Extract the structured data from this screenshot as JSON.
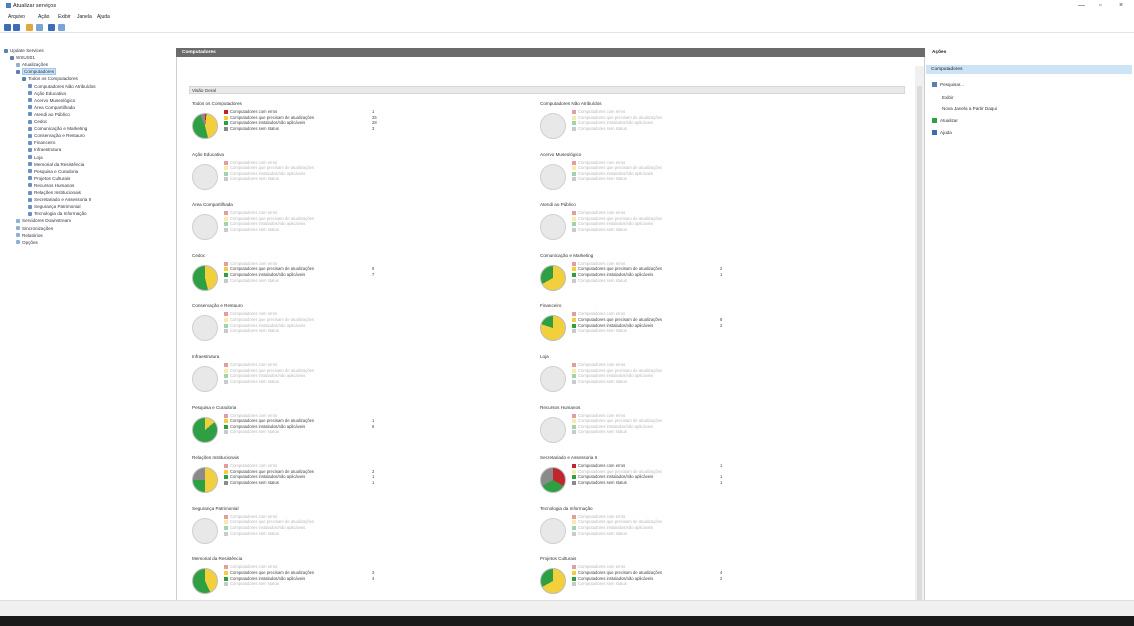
{
  "window": {
    "title": "Atualizar serviços",
    "minimize": "—",
    "maximize": "▫",
    "close": "×"
  },
  "menu": [
    "Arquivo",
    "Ação",
    "Exibir",
    "Janela",
    "Ajuda"
  ],
  "tree": [
    {
      "label": "Update Services",
      "indent": 0,
      "color": "#5b7fb0"
    },
    {
      "label": "WSUS01",
      "indent": 1,
      "color": "#5b7fb0"
    },
    {
      "label": "Atualizações",
      "indent": 2,
      "color": "#8fb0d6"
    },
    {
      "label": "Computadores",
      "indent": 2,
      "color": "#5b7fb0",
      "selected": true
    },
    {
      "label": "Todos os Computadores",
      "indent": 3,
      "color": "#5b7fb0"
    },
    {
      "label": "Computadores Não Atribuídos",
      "indent": 4,
      "color": "#6b8fbf"
    },
    {
      "label": "Ação Educativa",
      "indent": 4,
      "color": "#6b8fbf"
    },
    {
      "label": "Acervo Museológico",
      "indent": 4,
      "color": "#6b8fbf"
    },
    {
      "label": "Área Compartilhada",
      "indent": 4,
      "color": "#6b8fbf"
    },
    {
      "label": "Atendi ao Público",
      "indent": 4,
      "color": "#6b8fbf"
    },
    {
      "label": "Cedoc",
      "indent": 4,
      "color": "#6b8fbf"
    },
    {
      "label": "Comunicação e Marketing",
      "indent": 4,
      "color": "#6b8fbf"
    },
    {
      "label": "Conservação e Restauro",
      "indent": 4,
      "color": "#6b8fbf"
    },
    {
      "label": "Financeiro",
      "indent": 4,
      "color": "#6b8fbf"
    },
    {
      "label": "Infraestrutura",
      "indent": 4,
      "color": "#6b8fbf"
    },
    {
      "label": "Loja",
      "indent": 4,
      "color": "#6b8fbf"
    },
    {
      "label": "Memorial da Resistência",
      "indent": 4,
      "color": "#6b8fbf"
    },
    {
      "label": "Pesquisa e Curadoria",
      "indent": 4,
      "color": "#6b8fbf"
    },
    {
      "label": "Projetos Culturais",
      "indent": 4,
      "color": "#6b8fbf"
    },
    {
      "label": "Recursos Humanos",
      "indent": 4,
      "color": "#6b8fbf"
    },
    {
      "label": "Relações Institucionais",
      "indent": 4,
      "color": "#6b8fbf"
    },
    {
      "label": "Secretariado e Assessoria II",
      "indent": 4,
      "color": "#6b8fbf"
    },
    {
      "label": "Segurança Patrimonial",
      "indent": 4,
      "color": "#6b8fbf"
    },
    {
      "label": "Tecnologia da Informação",
      "indent": 4,
      "color": "#6b8fbf"
    },
    {
      "label": "Servidores Downstream",
      "indent": 2,
      "color": "#8fb0d6"
    },
    {
      "label": "Sincronizações",
      "indent": 2,
      "color": "#8fb0d6"
    },
    {
      "label": "Relatórios",
      "indent": 2,
      "color": "#8fb0d6"
    },
    {
      "label": "Opções",
      "indent": 2,
      "color": "#8fb0d6"
    }
  ],
  "center": {
    "header": "Computadores",
    "section": "Visão Geral"
  },
  "legend_colors": {
    "errors": "#c0262d",
    "needed": "#f2d03b",
    "installed": "#2ea043",
    "nostatus": "#8a8a8a"
  },
  "groups": [
    {
      "name": "Todos os Computadores",
      "active": true,
      "values": [
        "1",
        "25",
        "28",
        "3"
      ],
      "pie": [
        2,
        44,
        48,
        6
      ]
    },
    {
      "name": "Computadores Não Atribuídos",
      "active": false,
      "values": [
        "",
        "",
        "",
        ""
      ],
      "pie": []
    },
    {
      "name": "Ação Educativa",
      "active": false,
      "values": [
        "",
        "",
        "",
        ""
      ],
      "pie": []
    },
    {
      "name": "Acervo Museológico",
      "active": false,
      "values": [
        "",
        "",
        "",
        ""
      ],
      "pie": []
    },
    {
      "name": "Área Compartilhada",
      "active": false,
      "values": [
        "",
        "",
        "",
        ""
      ],
      "pie": []
    },
    {
      "name": "Atendi ao Público",
      "active": false,
      "values": [
        "",
        "",
        "",
        ""
      ],
      "pie": []
    },
    {
      "name": "Cedoc",
      "active": true,
      "values": [
        "",
        "6",
        "7",
        ""
      ],
      "pie": [
        0,
        46,
        54,
        0
      ]
    },
    {
      "name": "Comunicação e Marketing",
      "active": true,
      "values": [
        "",
        "2",
        "1",
        ""
      ],
      "pie": [
        0,
        67,
        33,
        0
      ]
    },
    {
      "name": "Conservação e Restauro",
      "active": false,
      "values": [
        "",
        "",
        "",
        ""
      ],
      "pie": []
    },
    {
      "name": "Financeiro",
      "active": true,
      "values": [
        "",
        "8",
        "2",
        ""
      ],
      "pie": [
        0,
        80,
        20,
        0
      ]
    },
    {
      "name": "Infraestrutura",
      "active": false,
      "values": [
        "",
        "",
        "",
        ""
      ],
      "pie": []
    },
    {
      "name": "Loja",
      "active": false,
      "values": [
        "",
        "",
        "",
        ""
      ],
      "pie": []
    },
    {
      "name": "Pesquisa e Curadoria",
      "active": true,
      "values": [
        "",
        "1",
        "6",
        ""
      ],
      "pie": [
        0,
        14,
        86,
        0
      ]
    },
    {
      "name": "Recursos Humanos",
      "active": false,
      "values": [
        "",
        "",
        "",
        ""
      ],
      "pie": []
    },
    {
      "name": "Relações Institucionais",
      "active": true,
      "values": [
        "",
        "2",
        "1",
        "1"
      ],
      "pie": [
        0,
        50,
        25,
        25
      ]
    },
    {
      "name": "Secretariado e Assessoria II",
      "active": true,
      "values": [
        "1",
        "",
        "1",
        "1"
      ],
      "pie": [
        33,
        0,
        34,
        33
      ]
    },
    {
      "name": "Segurança Patrimonial",
      "active": false,
      "values": [
        "",
        "",
        "",
        ""
      ],
      "pie": []
    },
    {
      "name": "Tecnologia da Informação",
      "active": false,
      "values": [
        "",
        "",
        "",
        ""
      ],
      "pie": []
    },
    {
      "name": "Memorial da Resistência",
      "active": true,
      "values": [
        "",
        "3",
        "4",
        ""
      ],
      "pie": [
        0,
        43,
        57,
        0
      ]
    },
    {
      "name": "Projetos Culturais",
      "active": true,
      "values": [
        "",
        "4",
        "2",
        ""
      ],
      "pie": [
        0,
        67,
        33,
        0
      ]
    }
  ],
  "legend_labels": [
    "Computadores com erros",
    "Computadores que precisam de atualizações",
    "Computadores instalados/não aplicáveis",
    "Computadores sem status"
  ],
  "actions": {
    "header": "Ações",
    "sub": "Computadores",
    "items": [
      {
        "label": "Pesquisar...",
        "color": "#5b7fb0"
      },
      {
        "label": "Exibir",
        "color": ""
      },
      {
        "label": "Nova Janela a Partir Daqui",
        "color": ""
      },
      {
        "label": "Atualizar",
        "color": "#2ea043"
      },
      {
        "label": "Ajuda",
        "color": "#3a6db5"
      }
    ]
  }
}
